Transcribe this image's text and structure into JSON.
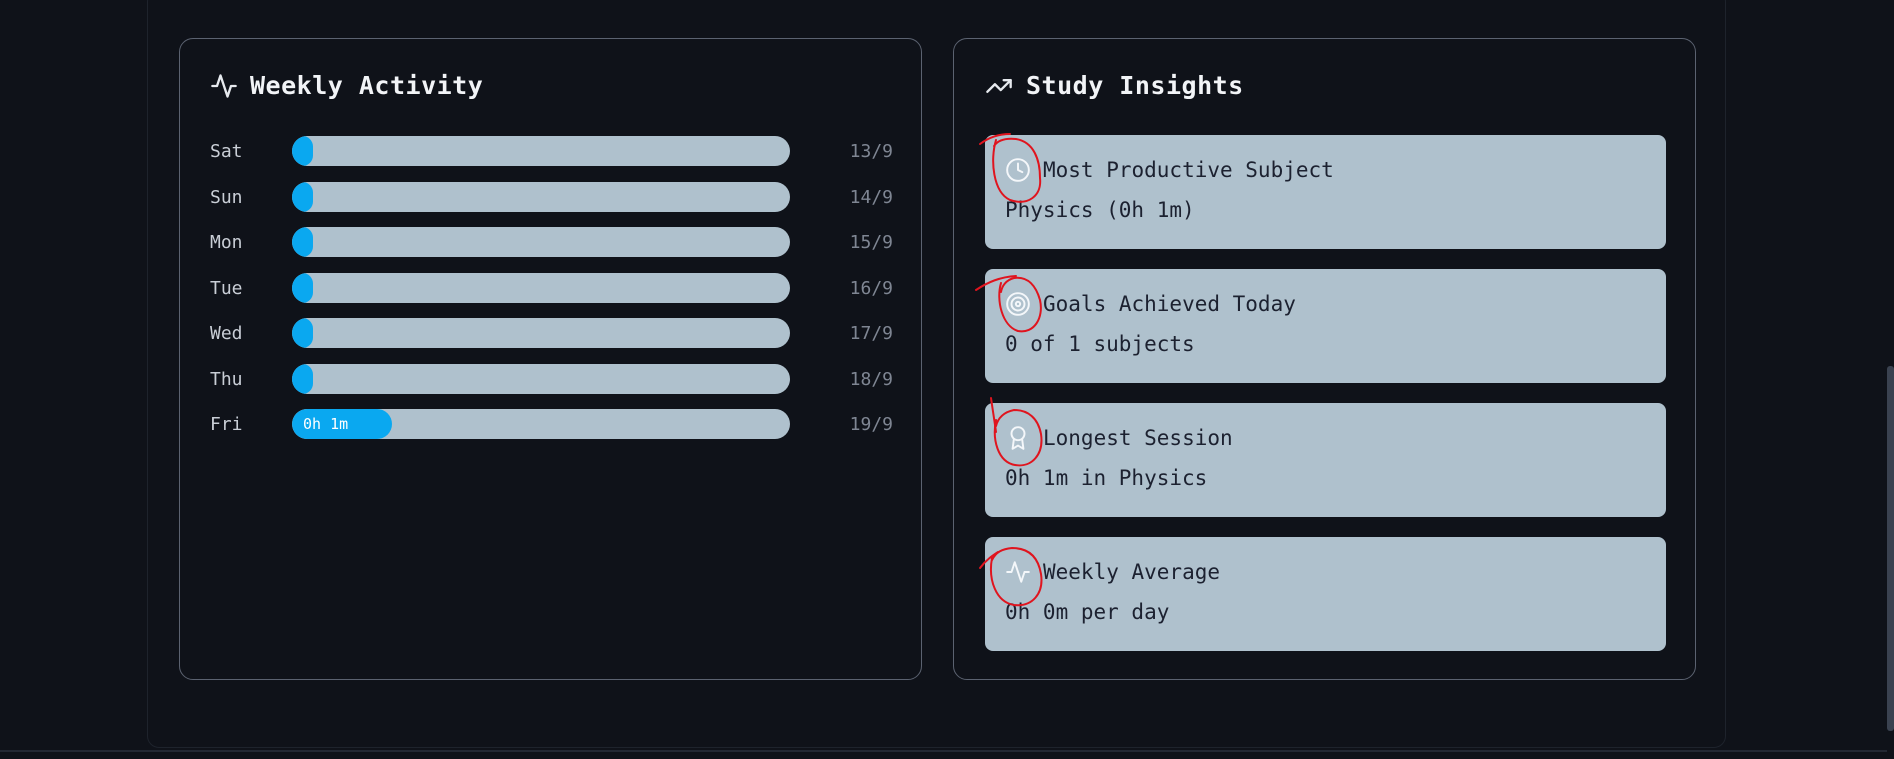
{
  "weekly_activity": {
    "title": "Weekly Activity",
    "icon": "activity-icon",
    "days": [
      {
        "day": "Sat",
        "date": "13/9",
        "fill_fraction": 0.04,
        "bar_label": ""
      },
      {
        "day": "Sun",
        "date": "14/9",
        "fill_fraction": 0.04,
        "bar_label": ""
      },
      {
        "day": "Mon",
        "date": "15/9",
        "fill_fraction": 0.04,
        "bar_label": ""
      },
      {
        "day": "Tue",
        "date": "16/9",
        "fill_fraction": 0.04,
        "bar_label": ""
      },
      {
        "day": "Wed",
        "date": "17/9",
        "fill_fraction": 0.04,
        "bar_label": ""
      },
      {
        "day": "Thu",
        "date": "18/9",
        "fill_fraction": 0.04,
        "bar_label": ""
      },
      {
        "day": "Fri",
        "date": "19/9",
        "fill_fraction": 0.2,
        "bar_label": "0h 1m"
      }
    ],
    "colors": {
      "track": "#afc1cd",
      "fill": "#0aa8f0"
    }
  },
  "study_insights": {
    "title": "Study Insights",
    "icon": "trending-up-icon",
    "items": [
      {
        "icon": "clock-icon",
        "label": "Most Productive Subject",
        "value": "Physics (0h 1m)"
      },
      {
        "icon": "target-icon",
        "label": "Goals Achieved Today",
        "value": "0 of 1 subjects"
      },
      {
        "icon": "award-icon",
        "label": "Longest Session",
        "value": "0h 1m in Physics"
      },
      {
        "icon": "activity-icon",
        "label": "Weekly Average",
        "value": "0h 0m per day"
      }
    ],
    "colors": {
      "box": "#afc1cd",
      "annotation": "#e0141e"
    }
  }
}
